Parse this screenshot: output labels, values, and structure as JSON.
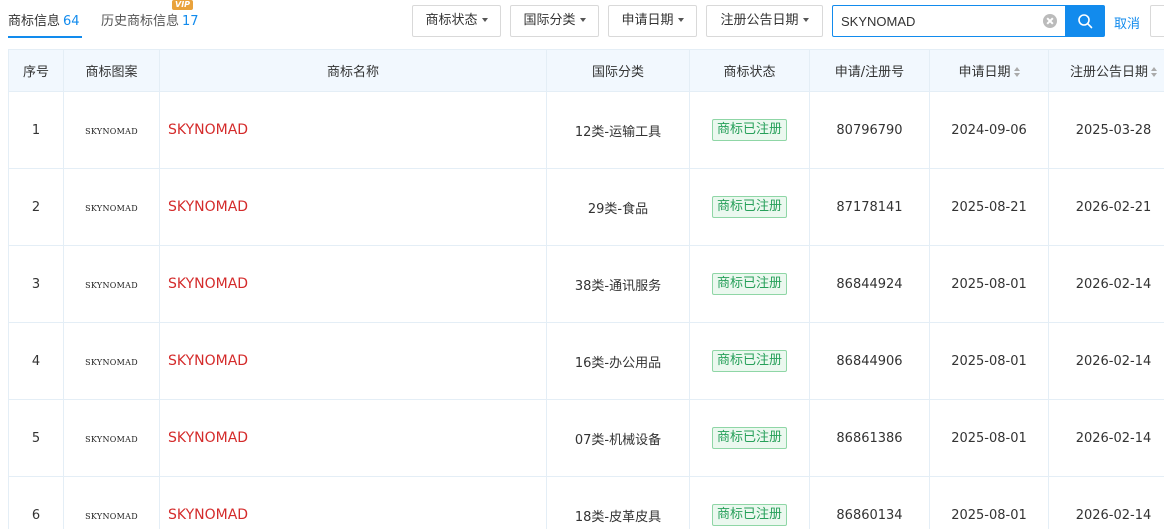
{
  "tabs": [
    {
      "label": "商标信息",
      "count": "64"
    },
    {
      "label": "历史商标信息",
      "count": "17",
      "badge": "VIP"
    }
  ],
  "filters": [
    {
      "label": "商标状态"
    },
    {
      "label": "国际分类"
    },
    {
      "label": "申请日期"
    },
    {
      "label": "注册公告日期"
    }
  ],
  "search": {
    "value": "SKYNOMAD",
    "cancel_label": "取消"
  },
  "table": {
    "headers": [
      "序号",
      "商标图案",
      "商标名称",
      "国际分类",
      "商标状态",
      "申请/注册号",
      "申请日期",
      "注册公告日期"
    ],
    "rows": [
      {
        "index": "1",
        "logo": "SKYNOMAD",
        "name": "SKYNOMAD",
        "class": "12类-运输工具",
        "status": "商标已注册",
        "reg_no": "80796790",
        "apply_date": "2024-09-06",
        "pub_date": "2025-03-28"
      },
      {
        "index": "2",
        "logo": "SKYNOMAD",
        "name": "SKYNOMAD",
        "class": "29类-食品",
        "status": "商标已注册",
        "reg_no": "87178141",
        "apply_date": "2025-08-21",
        "pub_date": "2026-02-21"
      },
      {
        "index": "3",
        "logo": "SKYNOMAD",
        "name": "SKYNOMAD",
        "class": "38类-通讯服务",
        "status": "商标已注册",
        "reg_no": "86844924",
        "apply_date": "2025-08-01",
        "pub_date": "2026-02-14"
      },
      {
        "index": "4",
        "logo": "SKYNOMAD",
        "name": "SKYNOMAD",
        "class": "16类-办公用品",
        "status": "商标已注册",
        "reg_no": "86844906",
        "apply_date": "2025-08-01",
        "pub_date": "2026-02-14"
      },
      {
        "index": "5",
        "logo": "SKYNOMAD",
        "name": "SKYNOMAD",
        "class": "07类-机械设备",
        "status": "商标已注册",
        "reg_no": "86861386",
        "apply_date": "2025-08-01",
        "pub_date": "2026-02-14"
      },
      {
        "index": "6",
        "logo": "SKYNOMAD",
        "name": "SKYNOMAD",
        "class": "18类-皮革皮具",
        "status": "商标已注册",
        "reg_no": "86860134",
        "apply_date": "2025-08-01",
        "pub_date": "2026-02-14"
      }
    ]
  },
  "colors": {
    "accent": "#128bed",
    "name_red": "#d42b2b",
    "status_green": "#27a05a"
  }
}
